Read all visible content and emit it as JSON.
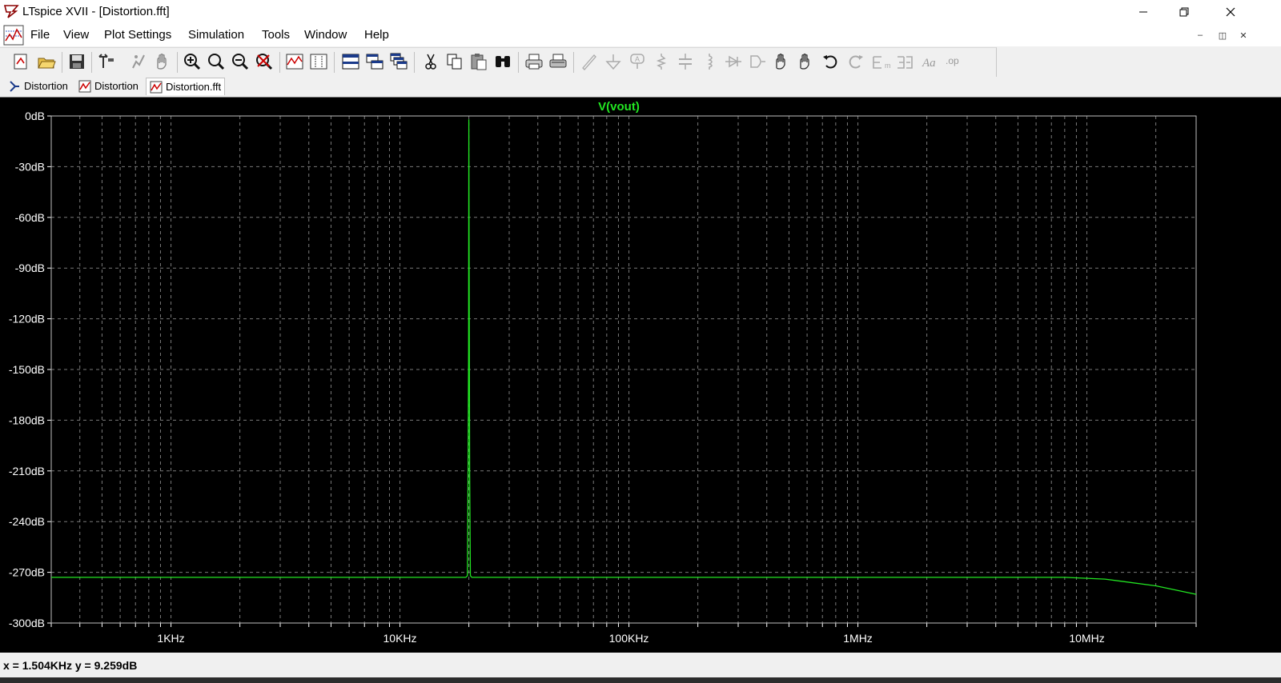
{
  "window": {
    "title": "LTspice XVII - [Distortion.fft]"
  },
  "menu": {
    "items": [
      {
        "name": "menu-file",
        "label": "File"
      },
      {
        "name": "menu-view",
        "label": "View"
      },
      {
        "name": "menu-plot-settings",
        "label": "Plot Settings"
      },
      {
        "name": "menu-simulation",
        "label": "Simulation"
      },
      {
        "name": "menu-tools",
        "label": "Tools"
      },
      {
        "name": "menu-window",
        "label": "Window"
      },
      {
        "name": "menu-help",
        "label": "Help"
      }
    ]
  },
  "toolbar": {
    "icons": [
      "new-schematic-icon",
      "open-icon",
      "save-icon",
      "control-panel-icon",
      "run-icon",
      "halt-icon",
      "zoom-in-icon",
      "zoom-full-icon",
      "zoom-out-icon",
      "autorange-icon",
      "plot-settings-icon",
      "plot-add-icon",
      "tile-horizontal-icon",
      "tile-vertical-icon",
      "cascade-icon",
      "cut-icon",
      "copy-icon",
      "paste-icon",
      "find-icon",
      "print-icon",
      "print-preview-icon",
      "wire-icon",
      "ground-icon",
      "label-net-icon",
      "resistor-icon",
      "capacitor-icon",
      "inductor-icon",
      "diode-icon",
      "component-icon",
      "move-icon",
      "drag-icon",
      "undo-icon",
      "redo-icon",
      "rotate-icon",
      "mirror-icon",
      "text-icon",
      "spice-directive-icon"
    ]
  },
  "tabs": [
    {
      "name": "tab-distortion-schematic",
      "label": "Distortion",
      "kind": "schematic"
    },
    {
      "name": "tab-distortion-waveform",
      "label": "Distortion",
      "kind": "waveform"
    },
    {
      "name": "tab-distortion-fft",
      "label": "Distortion.fft",
      "kind": "waveform",
      "active": true
    }
  ],
  "status": {
    "cursor_readout": "x = 1.504KHz    y = 9.259dB"
  },
  "colors": {
    "plot_background": "#000000",
    "trace": "#22e622",
    "grid": "#7a7a7a",
    "axis_text": "#ffffff"
  },
  "chart_data": {
    "type": "line",
    "title": "V(vout)",
    "xscale": "log",
    "xlim": [
      300,
      30000000
    ],
    "ylim": [
      -300,
      0
    ],
    "xticks": [
      1000,
      10000,
      100000,
      1000000,
      10000000
    ],
    "xtick_labels": [
      "1KHz",
      "10KHz",
      "100KHz",
      "1MHz",
      "10MHz"
    ],
    "yticks": [
      0,
      -30,
      -60,
      -90,
      -120,
      -150,
      -180,
      -210,
      -240,
      -270,
      -300
    ],
    "ytick_labels": [
      "0dB",
      "-30dB",
      "-60dB",
      "-90dB",
      "-120dB",
      "-150dB",
      "-180dB",
      "-210dB",
      "-240dB",
      "-270dB",
      "-300dB"
    ],
    "grid": true,
    "series": [
      {
        "name": "V(vout)",
        "color": "#22e622",
        "x": [
          300,
          1000,
          10000,
          19400,
          19700,
          19850,
          19950,
          20000,
          20050,
          20150,
          20300,
          20600,
          21000,
          100000,
          1000000,
          5000000,
          8000000,
          12000000,
          20000000,
          30000000
        ],
        "y": [
          -273,
          -273,
          -273,
          -273,
          -272,
          -205,
          -138,
          -2,
          -72,
          -210,
          -272,
          -273,
          -273,
          -273,
          -273,
          -273,
          -273,
          -274,
          -278,
          -283
        ]
      }
    ]
  }
}
